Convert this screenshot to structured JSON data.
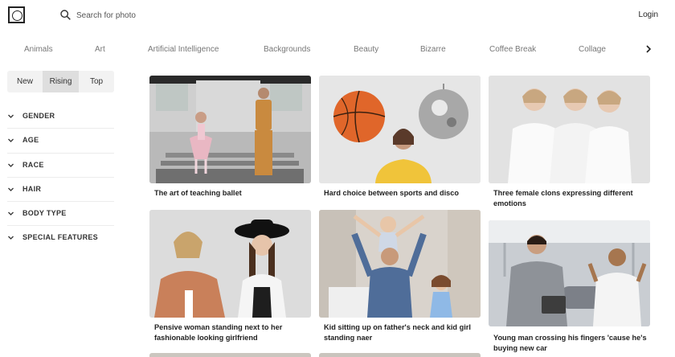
{
  "header": {
    "search_placeholder": "Search for photo",
    "login_label": "Login"
  },
  "categories": [
    "Animals",
    "Art",
    "Artificial Intelligence",
    "Backgrounds",
    "Beauty",
    "Bizarre",
    "Coffee Break",
    "Collage"
  ],
  "sort_tabs": [
    "New",
    "Rising",
    "Top"
  ],
  "active_sort": "Rising",
  "filters": [
    "GENDER",
    "AGE",
    "RACE",
    "HAIR",
    "BODY TYPE",
    "SPECIAL FEATURES"
  ],
  "photos": [
    {
      "caption": "The art of teaching ballet"
    },
    {
      "caption": "Hard choice between sports and disco"
    },
    {
      "caption": "Three female clons expressing different emotions"
    },
    {
      "caption": "Pensive woman standing next to her fashionable looking girlfriend"
    },
    {
      "caption": "Kid sitting up on father's neck and kid girl standing naer"
    },
    {
      "caption": "Young man crossing his fingers 'cause he's buying new car"
    }
  ],
  "colors": {
    "accent": "#222222",
    "muted": "#777777",
    "tab_bg": "#f2f2f2",
    "tab_active": "#dedede"
  }
}
